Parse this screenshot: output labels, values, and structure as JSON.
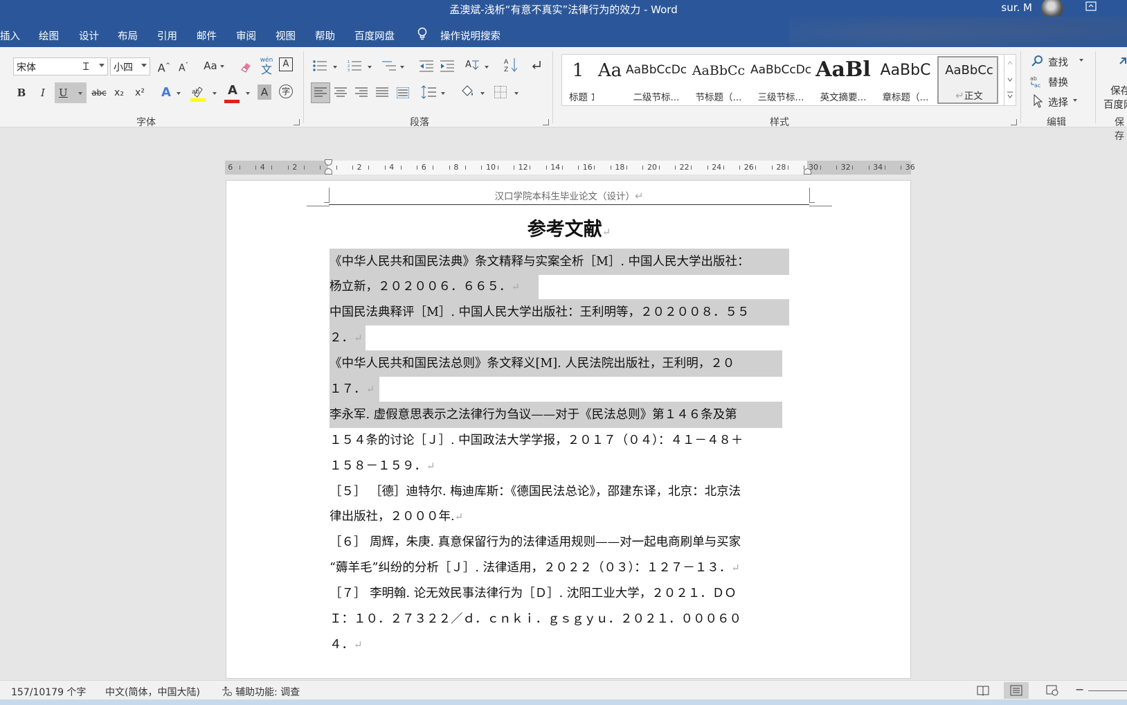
{
  "window": {
    "title": "孟澳斌-浅析“有意不真实”法律行为的效力  -  Word",
    "user": "sur. M"
  },
  "tabs": [
    {
      "label": "插入"
    },
    {
      "label": "绘图"
    },
    {
      "label": "设计"
    },
    {
      "label": "布局"
    },
    {
      "label": "引用"
    },
    {
      "label": "邮件"
    },
    {
      "label": "审阅"
    },
    {
      "label": "视图"
    },
    {
      "label": "帮助"
    },
    {
      "label": "百度网盘"
    }
  ],
  "tell_me": "操作说明搜索",
  "font_group": {
    "font_name": "宋体",
    "font_size": "小四",
    "label": "字体",
    "grow": "A",
    "shrink": "A",
    "change_case": "Aa",
    "bold": "B",
    "italic": "I",
    "underline": "U",
    "strike": "abc",
    "subscript": "x₂",
    "superscript": "x²",
    "phonetic": "文",
    "phonetic_small": "wén",
    "enclose": "字",
    "colors": {
      "highlight": "#ffff00",
      "font_color": "#e02020"
    }
  },
  "paragraph_group": {
    "label": "段落"
  },
  "styles_group": {
    "label": "样式",
    "items": [
      {
        "sample": "1",
        "name": "标题 1"
      },
      {
        "sample": "Aa",
        "name": ""
      },
      {
        "sample": "AaBbCcDc",
        "name": "二级节标..."
      },
      {
        "sample": "AaBbCc",
        "name": "节标题（..."
      },
      {
        "sample": "AaBbCcDc",
        "name": "三级节标..."
      },
      {
        "sample": "AaBl",
        "name": "英文摘要..."
      },
      {
        "sample": "AaBbC",
        "name": "章标题（..."
      },
      {
        "sample": "AaBbCc",
        "name": "正文"
      }
    ]
  },
  "editing_group": {
    "label": "编辑",
    "find": "查找",
    "replace": "替换",
    "select": "选择"
  },
  "save_group": {
    "line1": "保存",
    "line2": "百度网",
    "label": "保存"
  },
  "ruler": {
    "labels": [
      "6",
      "4",
      "2",
      "2",
      "4",
      "6",
      "8",
      "10",
      "12",
      "14",
      "16",
      "18",
      "20",
      "22",
      "24",
      "26",
      "28",
      "30",
      "32",
      "34",
      "36"
    ]
  },
  "document": {
    "header": "汉口学院本科生毕业论文（设计）",
    "heading": "参考文献",
    "paragraph_mark": "↵",
    "lines": [
      {
        "text": "《中华人民共和国民法典》条文精释与实案全析［M］. 中国人民大学出版社：",
        "highlight": true
      },
      {
        "text": "杨立新，２０２００６．６６５．",
        "highlight": true,
        "mark": true
      },
      {
        "text": "中国民法典释评［M］. 中国人民大学出版社：王利明等，２０２００８．５５",
        "highlight": true
      },
      {
        "text": "２．",
        "highlight": true,
        "mark": true
      },
      {
        "text": "《中华人民共和国民法总则》条文释义[M]. 人民法院出版社，王利明，２０",
        "highlight": true
      },
      {
        "text": "１７．",
        "highlight": true,
        "mark": true
      },
      {
        "text": "李永军. 虚假意思表示之法律行为刍议——对于《民法总则》第１４６条及第",
        "highlight": true
      },
      {
        "text": "１５４条的讨论［Ｊ］. 中国政法大学学报，２０１７（０４）：４１－４８＋",
        "highlight": false
      },
      {
        "text": "１５８－１５９．",
        "highlight": false,
        "mark": true
      },
      {
        "text": "［５］ ［德］迪特尔. 梅迪库斯：《德国民法总论》，邵建东译，北京：北京法",
        "highlight": false
      },
      {
        "text": "律出版社，２０００年.",
        "highlight": false,
        "mark": true
      },
      {
        "text": "［６］ 周辉，朱庚. 真意保留行为的法律适用规则——对一起电商刷单与买家",
        "highlight": false
      },
      {
        "text": "“薅羊毛”纠纷的分析［Ｊ］. 法律适用，２０２２（０３）：１２７－１３．",
        "highlight": false,
        "mark": true
      },
      {
        "text": "［７］ 李明翰.  论无效民事法律行为［Ｄ］. 沈阳工业大学，２０２１．ＤＯ",
        "highlight": false
      },
      {
        "text": "Ｉ：１０．２７３２２／ｄ．ｃｎｋｉ．ｇｓｇｙｕ．２０２１．０００６０",
        "highlight": false
      },
      {
        "text": "４．",
        "highlight": false,
        "mark": true
      }
    ]
  },
  "status": {
    "word_count": "157/10179 个字",
    "language": "中文(简体，中国大陆)",
    "accessibility": "辅助功能: 调查"
  }
}
